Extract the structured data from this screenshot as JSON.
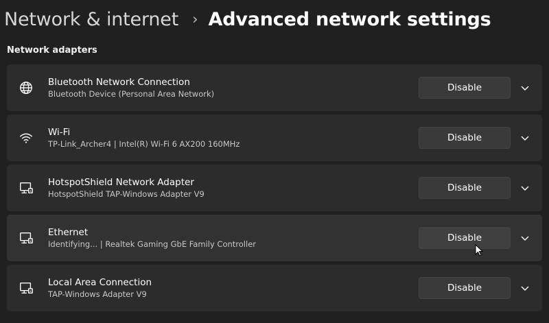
{
  "breadcrumb": {
    "parent": "Network & internet",
    "separator": "›",
    "current": "Advanced network settings"
  },
  "section": {
    "title": "Network adapters"
  },
  "adapters": [
    {
      "title": "Bluetooth Network Connection",
      "subtitle": "Bluetooth Device (Personal Area Network)",
      "icon": "globe-icon",
      "button_label": "Disable"
    },
    {
      "title": "Wi-Fi",
      "subtitle": "TP-Link_Archer4 | Intel(R) Wi-Fi 6 AX200 160MHz",
      "icon": "wifi-icon",
      "button_label": "Disable"
    },
    {
      "title": "HotspotShield Network Adapter",
      "subtitle": "HotspotShield TAP-Windows Adapter V9",
      "icon": "ethernet-icon",
      "button_label": "Disable"
    },
    {
      "title": "Ethernet",
      "subtitle": "Identifying... | Realtek Gaming GbE Family Controller",
      "icon": "ethernet-icon",
      "button_label": "Disable"
    },
    {
      "title": "Local Area Connection",
      "subtitle": "TAP-Windows Adapter V9",
      "icon": "ethernet-icon",
      "button_label": "Disable"
    }
  ],
  "colors": {
    "background": "#202020",
    "card": "#2c2c2c",
    "button": "#3a3a3a",
    "text": "#ffffff",
    "secondary_text": "#c8c8c8"
  }
}
